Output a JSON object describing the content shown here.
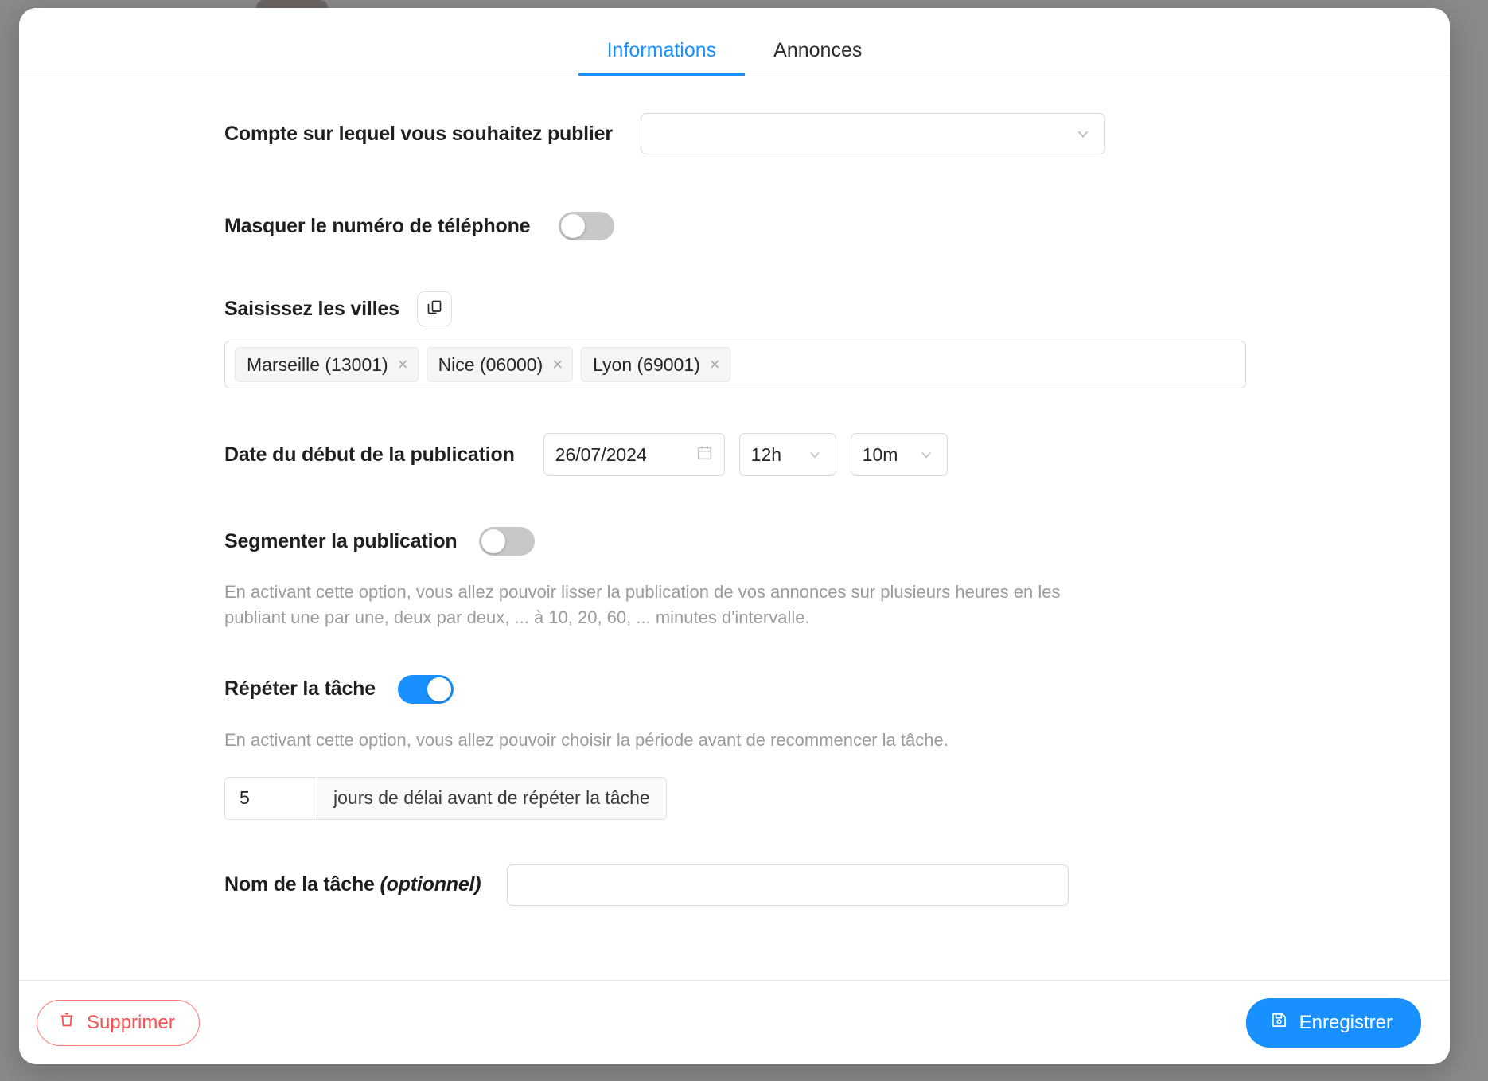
{
  "tabs": [
    {
      "label": "Informations",
      "active": true
    },
    {
      "label": "Annonces",
      "active": false
    }
  ],
  "form": {
    "account": {
      "label": "Compte sur lequel vous souhaitez publier",
      "value": "",
      "placeholder": ""
    },
    "hide_phone": {
      "label": "Masquer le numéro de téléphone",
      "enabled": false
    },
    "cities": {
      "label": "Saisissez les villes",
      "copy_icon": "copy-icon",
      "chips": [
        {
          "text": "Marseille (13001)",
          "remove": "×"
        },
        {
          "text": "Nice (06000)",
          "remove": "×"
        },
        {
          "text": "Lyon (69001)",
          "remove": "×"
        }
      ]
    },
    "start_date": {
      "label": "Date du début de la publication",
      "date_value": "26/07/2024",
      "calendar_icon": "calendar-icon",
      "hour_value": "12h",
      "minute_value": "10m"
    },
    "segment": {
      "label": "Segmenter la publication",
      "enabled": false,
      "helper": "En activant cette option, vous allez pouvoir lisser la publication de vos annonces sur plusieurs heures en les publiant une par une, deux par deux, ... à 10, 20, 60, ... minutes d'intervalle."
    },
    "repeat": {
      "label": "Répéter la tâche",
      "enabled": true,
      "helper": "En activant cette option, vous allez pouvoir choisir la période avant de recommencer la tâche.",
      "delay_value": "5",
      "delay_addon": "jours de délai avant de répéter la tâche"
    },
    "task_name": {
      "label": "Nom de la tâche",
      "optional_suffix": "(optionnel)",
      "value": "",
      "placeholder": ""
    }
  },
  "footer": {
    "delete_label": "Supprimer",
    "save_label": "Enregistrer"
  },
  "colors": {
    "accent": "#1890ff",
    "danger": "#ff4d4f",
    "backdrop": "#8a8a8a",
    "helper_text": "#9b9b9b"
  }
}
